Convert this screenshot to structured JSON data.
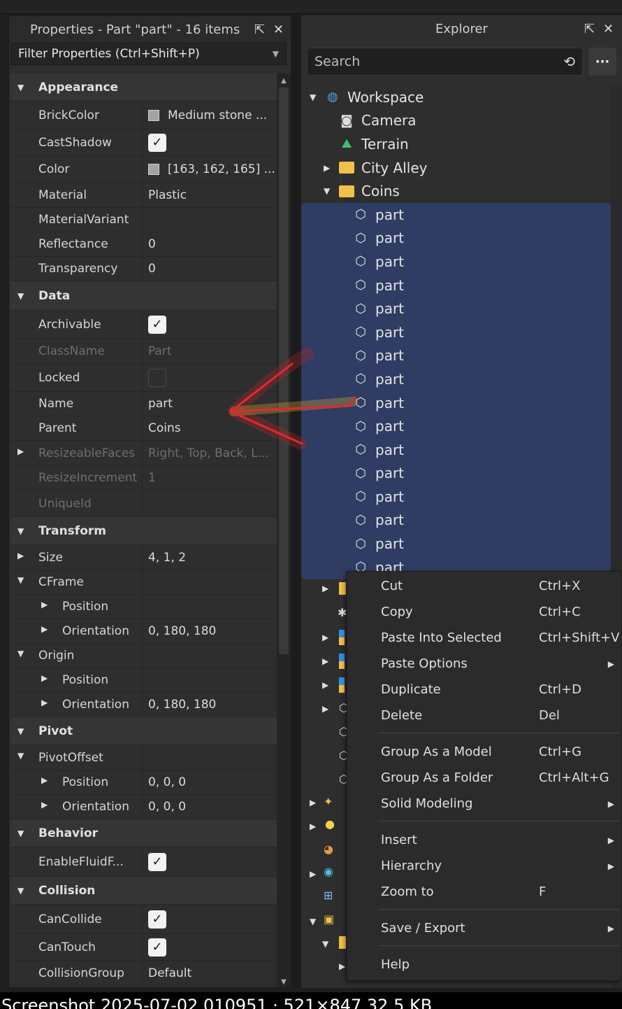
{
  "properties": {
    "title": "Properties - Part \"part\" - 16 items",
    "filter_label": "Filter Properties (Ctrl+Shift+P)",
    "rows": [
      {
        "type": "section",
        "label": "Appearance",
        "h": 40
      },
      {
        "type": "prop",
        "label": "BrickColor",
        "value": "Medium stone ...",
        "swatch": true,
        "h": 40
      },
      {
        "type": "prop",
        "label": "CastShadow",
        "check": "on",
        "h": 38
      },
      {
        "type": "prop",
        "label": "Color",
        "value": "[163, 162, 165] ...",
        "swatch": true,
        "h": 38
      },
      {
        "type": "prop",
        "label": "Material",
        "value": "Plastic",
        "h": 36
      },
      {
        "type": "prop",
        "label": "MaterialVariant",
        "value": "",
        "h": 35
      },
      {
        "type": "prop",
        "label": "Reflectance",
        "value": "0",
        "h": 35
      },
      {
        "type": "prop",
        "label": "Transparency",
        "value": "0",
        "h": 35
      },
      {
        "type": "section",
        "label": "Data",
        "h": 42
      },
      {
        "type": "prop",
        "label": "Archivable",
        "check": "on",
        "h": 40
      },
      {
        "type": "prop",
        "label": "ClassName",
        "value": "Part",
        "dim": true,
        "h": 36
      },
      {
        "type": "prop",
        "label": "Locked",
        "check": "off",
        "h": 40
      },
      {
        "type": "prop",
        "label": "Name",
        "value": "part",
        "h": 35
      },
      {
        "type": "prop",
        "label": "Parent",
        "value": "Coins",
        "h": 35
      },
      {
        "type": "prop",
        "label": "ResizeableFaces",
        "value": "Right, Top, Back, L...",
        "dim": true,
        "arrow": "right",
        "h": 36
      },
      {
        "type": "prop",
        "label": "ResizeIncrement",
        "value": "1",
        "dim": true,
        "h": 35
      },
      {
        "type": "prop",
        "label": "UniqueId",
        "value": "",
        "dim": true,
        "h": 38
      },
      {
        "type": "section",
        "label": "Transform",
        "h": 40
      },
      {
        "type": "prop",
        "label": "Size",
        "value": "4, 1, 2",
        "arrow": "right",
        "h": 36
      },
      {
        "type": "prop",
        "label": "CFrame",
        "value": "",
        "arrow": "down",
        "h": 35
      },
      {
        "type": "prop",
        "label": "Position",
        "value": "",
        "arrow": "right",
        "sub": true,
        "h": 35
      },
      {
        "type": "prop",
        "label": "Orientation",
        "value": "0, 180, 180",
        "arrow": "right",
        "sub": true,
        "h": 35
      },
      {
        "type": "prop",
        "label": "Origin",
        "value": "",
        "arrow": "down",
        "h": 35
      },
      {
        "type": "prop",
        "label": "Position",
        "value": "",
        "arrow": "right",
        "sub": true,
        "h": 35
      },
      {
        "type": "prop",
        "label": "Orientation",
        "value": "0, 180, 180",
        "arrow": "right",
        "sub": true,
        "h": 35
      },
      {
        "type": "section",
        "label": "Pivot",
        "h": 40
      },
      {
        "type": "prop",
        "label": "PivotOffset",
        "value": "",
        "arrow": "down",
        "h": 36
      },
      {
        "type": "prop",
        "label": "Position",
        "value": "0, 0, 0",
        "arrow": "right",
        "sub": true,
        "h": 35
      },
      {
        "type": "prop",
        "label": "Orientation",
        "value": "0, 0, 0",
        "arrow": "right",
        "sub": true,
        "h": 35
      },
      {
        "type": "section",
        "label": "Behavior",
        "h": 40
      },
      {
        "type": "prop",
        "label": "EnableFluidF...",
        "check": "on",
        "h": 42
      },
      {
        "type": "section",
        "label": "Collision",
        "h": 40
      },
      {
        "type": "prop",
        "label": "CanCollide",
        "check": "on",
        "h": 42
      },
      {
        "type": "prop",
        "label": "CanTouch",
        "check": "on",
        "h": 38
      },
      {
        "type": "prop",
        "label": "CollisionGroup",
        "value": "Default",
        "h": 36
      }
    ]
  },
  "explorer": {
    "title": "Explorer",
    "search_placeholder": "Search",
    "more_label": "···",
    "tree": [
      {
        "label": "Workspace",
        "icon": "globe-icon",
        "indent": 0,
        "arrow": "down"
      },
      {
        "label": "Camera",
        "icon": "camera-icon",
        "indent": 1
      },
      {
        "label": "Terrain",
        "icon": "terrain-icon",
        "indent": 1
      },
      {
        "label": "City Alley",
        "icon": "folder-icon",
        "indent": 1,
        "arrow": "right"
      },
      {
        "label": "Coins",
        "icon": "folder-icon",
        "indent": 1,
        "arrow": "down"
      },
      {
        "label": "part",
        "icon": "part-icon",
        "indent": 2
      },
      {
        "label": "part",
        "icon": "part-icon",
        "indent": 2
      },
      {
        "label": "part",
        "icon": "part-icon",
        "indent": 2
      },
      {
        "label": "part",
        "icon": "part-icon",
        "indent": 2
      },
      {
        "label": "part",
        "icon": "part-icon",
        "indent": 2
      },
      {
        "label": "part",
        "icon": "part-icon",
        "indent": 2
      },
      {
        "label": "part",
        "icon": "part-icon",
        "indent": 2
      },
      {
        "label": "part",
        "icon": "part-icon",
        "indent": 2
      },
      {
        "label": "part",
        "icon": "part-icon",
        "indent": 2
      },
      {
        "label": "part",
        "icon": "part-icon",
        "indent": 2
      },
      {
        "label": "part",
        "icon": "part-icon",
        "indent": 2
      },
      {
        "label": "part",
        "icon": "part-icon",
        "indent": 2
      },
      {
        "label": "part",
        "icon": "part-icon",
        "indent": 2
      },
      {
        "label": "part",
        "icon": "part-icon",
        "indent": 2
      },
      {
        "label": "part",
        "icon": "part-icon",
        "indent": 2
      },
      {
        "label": "part",
        "icon": "part-icon",
        "indent": 2
      }
    ]
  },
  "context_menu": {
    "items": [
      {
        "label": "Cut",
        "shortcut": "Ctrl+X"
      },
      {
        "label": "Copy",
        "shortcut": "Ctrl+C"
      },
      {
        "label": "Paste Into Selected",
        "shortcut": "Ctrl+Shift+V"
      },
      {
        "label": "Paste Options",
        "shortcut": "",
        "submenu": true
      },
      {
        "label": "Duplicate",
        "shortcut": "Ctrl+D"
      },
      {
        "label": "Delete",
        "shortcut": "Del"
      },
      {
        "sep": true
      },
      {
        "label": "Group As a Model",
        "shortcut": "Ctrl+G"
      },
      {
        "label": "Group As a Folder",
        "shortcut": "Ctrl+Alt+G"
      },
      {
        "label": "Solid Modeling",
        "shortcut": "",
        "submenu": true
      },
      {
        "sep": true
      },
      {
        "label": "Insert",
        "shortcut": "",
        "submenu": true
      },
      {
        "label": "Hierarchy",
        "shortcut": "",
        "submenu": true
      },
      {
        "label": "Zoom to",
        "shortcut": "F"
      },
      {
        "sep": true
      },
      {
        "label": "Save / Export",
        "shortcut": "",
        "submenu": true
      },
      {
        "sep": true
      },
      {
        "label": "Help",
        "shortcut": ""
      }
    ]
  },
  "caption": "Screenshot 2025-07-02 010951 · 521×847 32.5 KB",
  "colors": {
    "selection": "#2f3c63",
    "panel": "#2e2e2e",
    "annotation_arrow": "#e8262b",
    "folder": "#f1c04b"
  }
}
